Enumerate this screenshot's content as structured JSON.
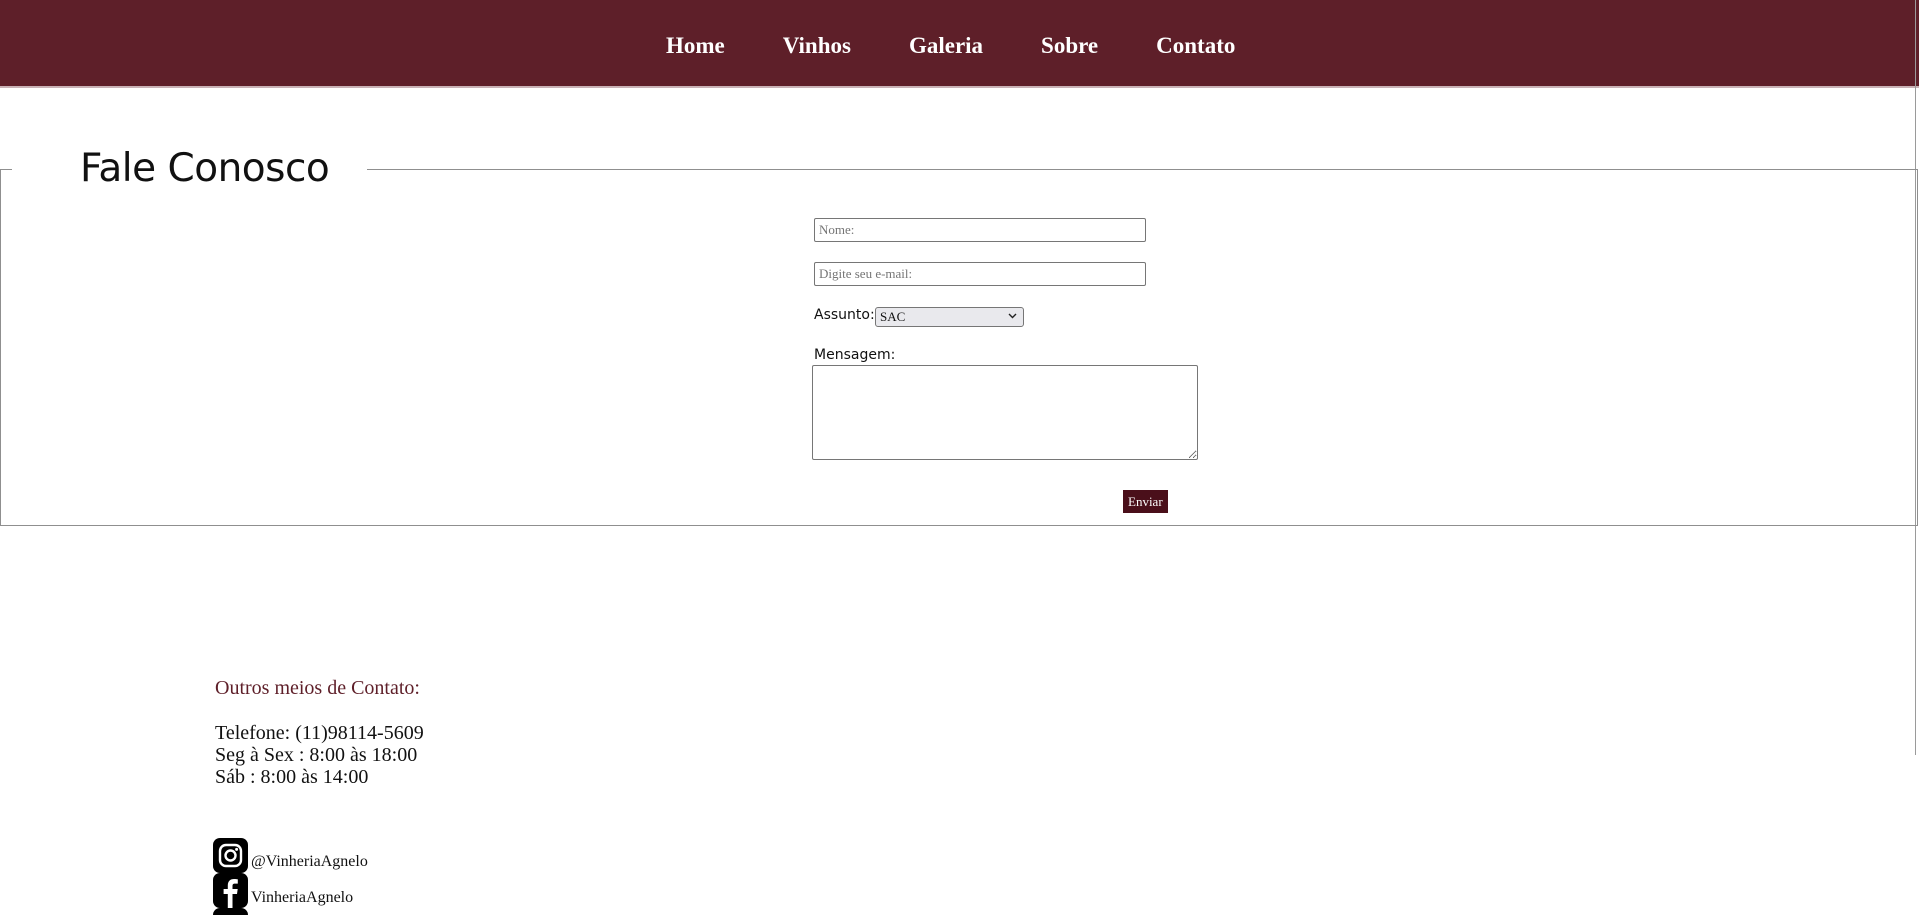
{
  "nav": {
    "items": [
      {
        "label": "Home"
      },
      {
        "label": "Vinhos"
      },
      {
        "label": "Galeria"
      },
      {
        "label": "Sobre"
      },
      {
        "label": "Contato"
      }
    ]
  },
  "form": {
    "legend": "Fale Conosco",
    "name_placeholder": "Nome:",
    "email_placeholder": "Digite seu e-mail:",
    "subject_label": "Assunto:",
    "subject_value": "SAC",
    "message_label": "Mensagem:",
    "message_value": "",
    "submit_label": "Enviar"
  },
  "contact": {
    "heading": "Outros meios de Contato:",
    "phone": "Telefone: (11)98114-5609",
    "hours_week": "Seg à Sex : 8:00 às 18:00",
    "hours_sat": "Sáb : 8:00 às 14:00",
    "social": [
      {
        "icon": "instagram-icon",
        "label": "@VinheriaAgnelo"
      },
      {
        "icon": "facebook-icon",
        "label": "VinheriaAgnelo"
      },
      {
        "icon": "social-icon",
        "label": ""
      }
    ]
  },
  "colors": {
    "nav_background": "#5e1f29",
    "button_background": "#4a0f1a",
    "heading_accent": "#5e1f29"
  }
}
